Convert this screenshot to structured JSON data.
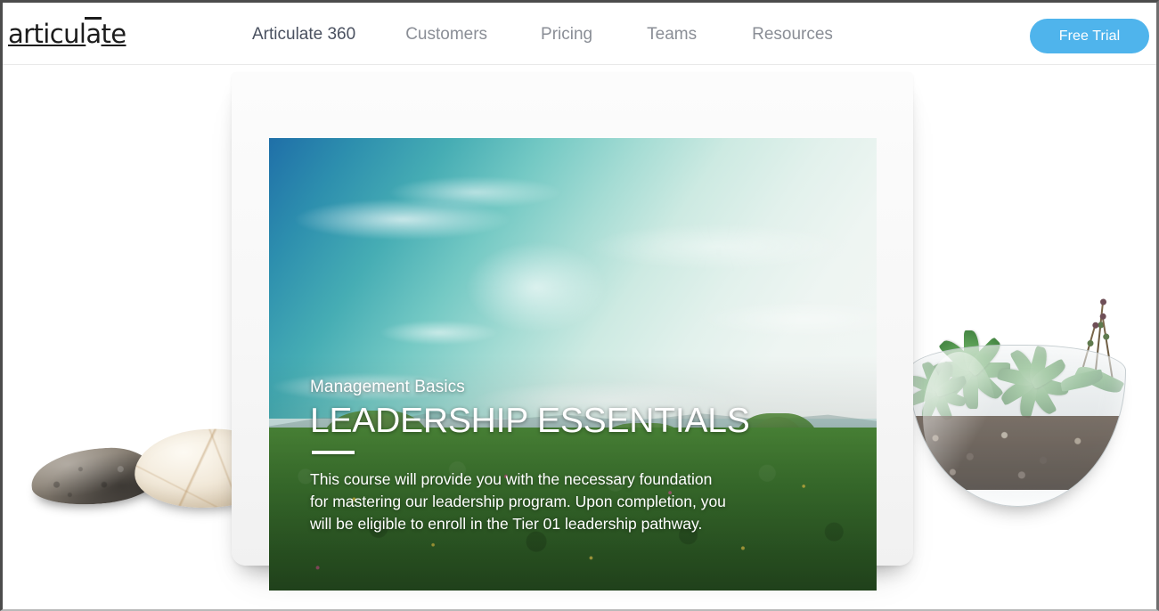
{
  "header": {
    "logo_text": "articulate",
    "logo_pre": "articul",
    "logo_macron_letter": "a",
    "logo_post": "te",
    "nav": [
      {
        "label": "Articulate 360",
        "name": "nav-articulate-360",
        "primary": true
      },
      {
        "label": "Customers",
        "name": "nav-customers",
        "primary": false
      },
      {
        "label": "Pricing",
        "name": "nav-pricing",
        "primary": false
      },
      {
        "label": "Teams",
        "name": "nav-teams",
        "primary": false
      },
      {
        "label": "Resources",
        "name": "nav-resources",
        "primary": false
      }
    ],
    "cta": {
      "label": "Free Trial",
      "background_color": "#4fb4ec",
      "text_color": "#ffffff"
    }
  },
  "hero": {
    "device": {
      "type": "tablet-frame",
      "bezel_color": "#f7f7f7"
    },
    "course_card": {
      "eyebrow": "Management Basics",
      "title": "LEADERSHIP ESSENTIALS",
      "description": "This course will provide you with the necessary foundation for mastering our leadership program. Upon completion, you will be eligible to enroll in the Tier 01 leadership pathway.",
      "text_color": "#ffffff",
      "background_image_description": "Teal sky with wispy cirrus clouds over granite inselberg domes and lush green tropical hills"
    },
    "decorations": {
      "stones_alt": "Two smooth stones, one dark gray and one cream colored",
      "terrarium_alt": "Glass bowl terrarium planted with green succulents in dark gravel soil"
    }
  },
  "colors": {
    "accent_blue": "#4fb4ec",
    "nav_text": "#8a8e96",
    "nav_text_active": "#4a5160",
    "logo_black": "#1c1c1c",
    "page_background": "#ffffff",
    "header_border": "#e9e9e9"
  }
}
